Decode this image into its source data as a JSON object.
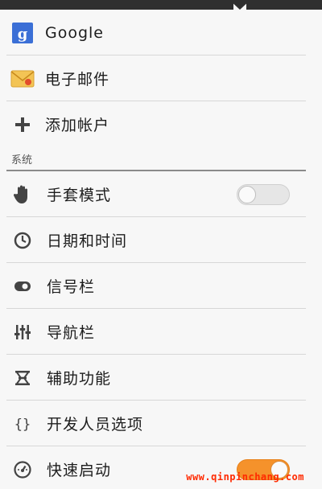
{
  "accounts": [
    {
      "label": "Google",
      "icon": "google-icon"
    },
    {
      "label": "电子邮件",
      "icon": "email-envelope-icon"
    },
    {
      "label": "添加帐户",
      "icon": "plus-icon"
    }
  ],
  "system_section": {
    "title": "系统"
  },
  "system_items": [
    {
      "label": "手套模式",
      "icon": "glove-hand-icon",
      "toggle": "off"
    },
    {
      "label": "日期和时间",
      "icon": "clock-icon"
    },
    {
      "label": "信号栏",
      "icon": "status-bar-icon"
    },
    {
      "label": "导航栏",
      "icon": "equalizer-sliders-icon"
    },
    {
      "label": "辅助功能",
      "icon": "accessibility-icon"
    },
    {
      "label": "开发人员选项",
      "icon": "braces-icon"
    },
    {
      "label": "快速启动",
      "icon": "speedometer-icon",
      "toggle": "on"
    }
  ],
  "watermark": "www.qinpinchang.com",
  "colors": {
    "toggle_on": "#f5922b",
    "google_blue": "#3b6fd6"
  }
}
